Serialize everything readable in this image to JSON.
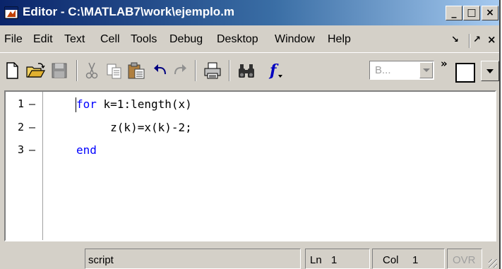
{
  "window": {
    "title": "Editor - C:\\MATLAB7\\work\\ejemplo.m",
    "controls": {
      "minimize": "_",
      "maximize": "□",
      "close": "×"
    }
  },
  "menu": {
    "items": [
      "File",
      "Edit",
      "Text",
      "Cell",
      "Tools",
      "Debug",
      "Desktop",
      "Window",
      "Help"
    ],
    "dock_icons": [
      "undock-icon",
      "maximize-arrow-icon",
      "close-x-icon"
    ]
  },
  "toolbar": {
    "icons": [
      "new-file-icon",
      "open-folder-icon",
      "save-icon",
      "cut-icon",
      "copy-icon",
      "paste-icon",
      "undo-icon",
      "redo-icon",
      "print-icon",
      "find-icon",
      "function-icon"
    ],
    "combo_value": "B...",
    "overflow_chevron": "»"
  },
  "editor": {
    "lines": [
      {
        "number": "1",
        "marker": "–",
        "keyword": "for",
        "text": " k=1:length(x)"
      },
      {
        "number": "2",
        "marker": "–",
        "keyword": "",
        "text": "     z(k)=x(k)-2;"
      },
      {
        "number": "3",
        "marker": "–",
        "keyword": "end",
        "text": ""
      }
    ],
    "keyword_color": "#0000ff"
  },
  "status": {
    "mode": "script",
    "ln_label": "Ln",
    "ln_value": "1",
    "col_label": "Col",
    "col_value": "1",
    "ovr": "OVR"
  }
}
